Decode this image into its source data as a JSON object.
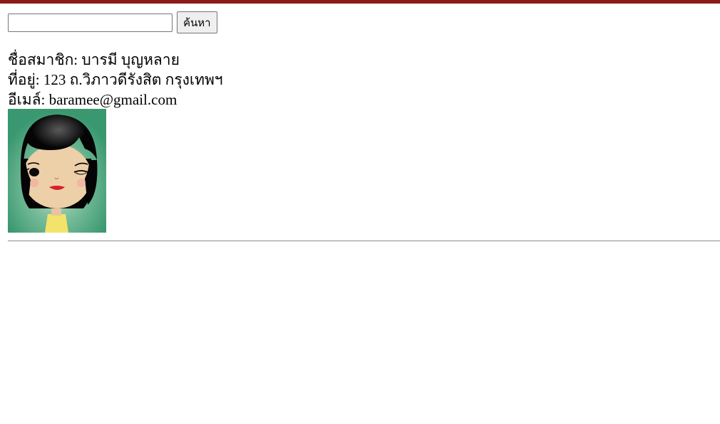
{
  "search": {
    "value": "",
    "placeholder": "",
    "button_label": "ค้นหา"
  },
  "member": {
    "name_label": "ชื่อสมาชิก: ",
    "name_value": "บารมี บุญหลาย",
    "address_label": "ที่อยู่: ",
    "address_value": "123 ถ.วิภาวดีรังสิต กรุงเทพฯ",
    "email_label": "อีเมล์: ",
    "email_value": "baramee@gmail.com"
  },
  "colors": {
    "top_bar": "#8b1a1a",
    "avatar_background": "#3a9870"
  },
  "avatar": {
    "icon": "cartoon-girl-avatar"
  }
}
